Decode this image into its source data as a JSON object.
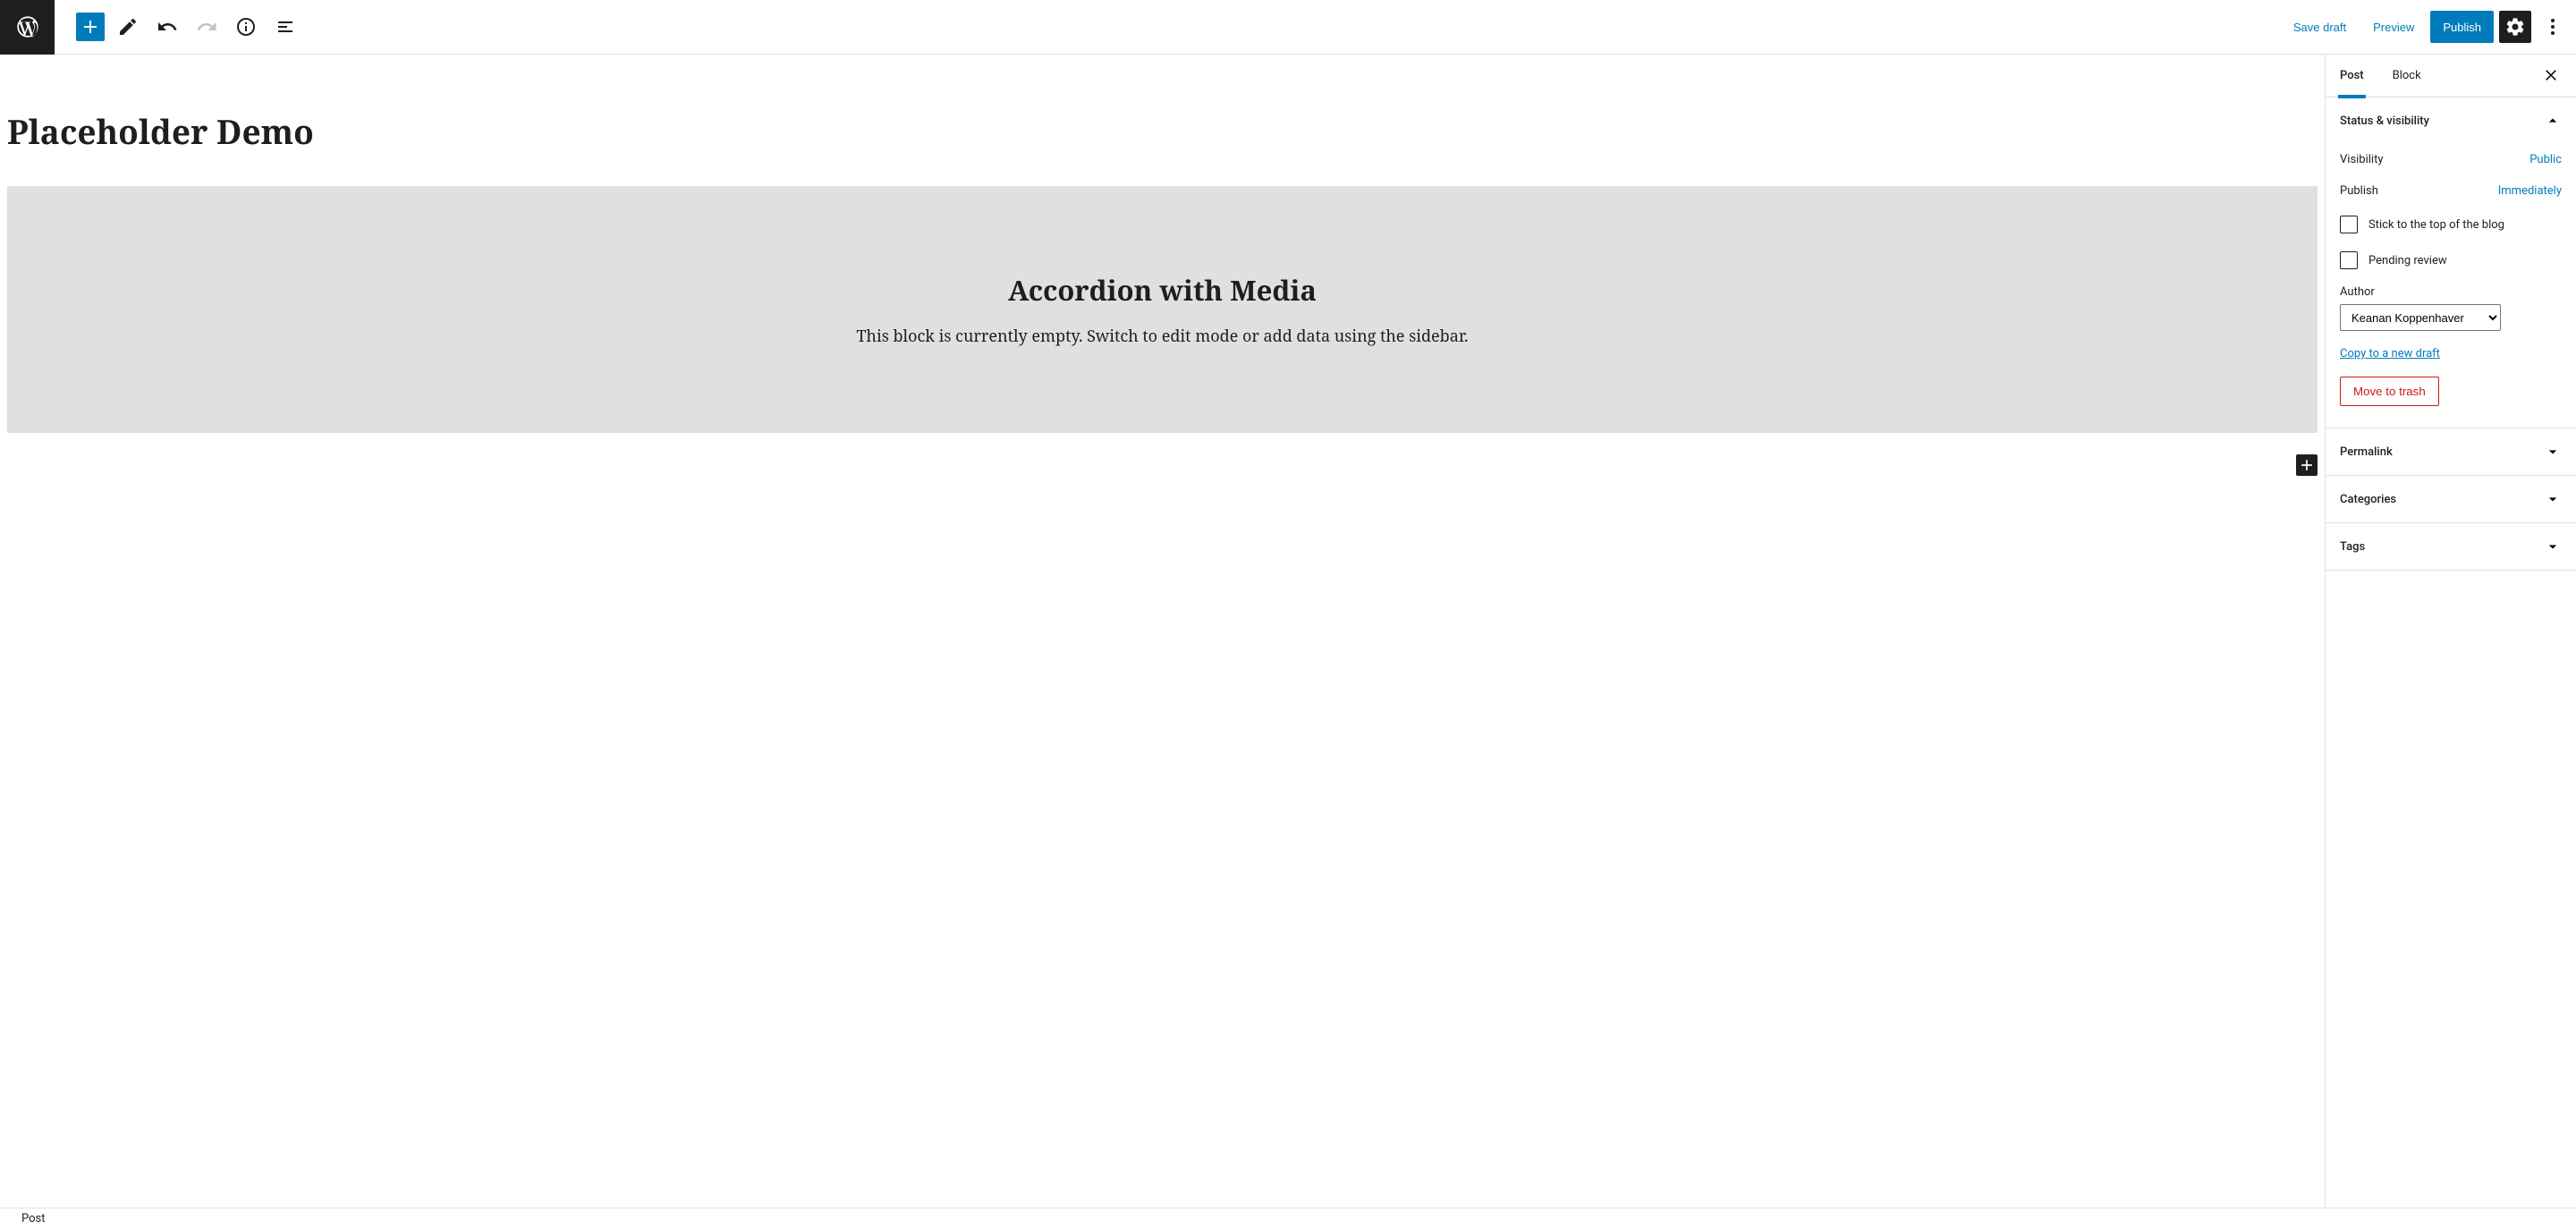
{
  "toolbar": {
    "save_draft": "Save draft",
    "preview": "Preview",
    "publish": "Publish"
  },
  "editor": {
    "post_title": "Placeholder Demo",
    "block": {
      "heading": "Accordion with Media",
      "empty_text": "This block is currently empty. Switch to edit mode or add data using the sidebar."
    }
  },
  "sidebar": {
    "tabs": {
      "post": "Post",
      "block": "Block"
    },
    "status_panel": {
      "title": "Status & visibility",
      "visibility_label": "Visibility",
      "visibility_value": "Public",
      "publish_label": "Publish",
      "publish_value": "Immediately",
      "stick_label": "Stick to the top of the blog",
      "pending_label": "Pending review",
      "author_label": "Author",
      "author_value": "Keanan Koppenhaver",
      "copy_draft": "Copy to a new draft",
      "trash": "Move to trash"
    },
    "permalink": "Permalink",
    "categories": "Categories",
    "tags": "Tags"
  },
  "footer": {
    "breadcrumb": "Post"
  }
}
